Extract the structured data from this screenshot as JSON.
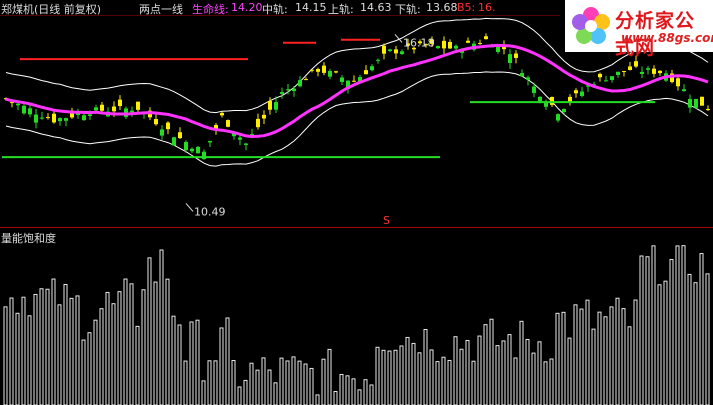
{
  "header": {
    "security": "郑煤机(日线 前复权)",
    "indicator_name": "两点一线",
    "life_line_label": "生命线:",
    "life_line_value": "14.20",
    "mid_label": "中轨:",
    "mid_value": "14.15",
    "upper_label": "上轨:",
    "upper_value": "14.63",
    "lower_label": "下轨:",
    "lower_value": "13.68",
    "b5_label": "B5:",
    "b5_value": "16."
  },
  "subchart": {
    "title": "量能饱和度"
  },
  "logo": {
    "brand": "分析家公式网",
    "url": "www.88gs.com"
  },
  "colors": {
    "up": "#22dd22",
    "down": "#ffee00",
    "life_line": "#ff33ff",
    "band": "#ffffff",
    "support": "#22dd22",
    "resistance": "#ff2222",
    "grid": "#aa0000"
  },
  "chart_data": {
    "type": "candlestick",
    "price_range": [
      10.0,
      16.8
    ],
    "annotations": [
      {
        "text": "10.49",
        "price": 10.49,
        "kind": "low"
      },
      {
        "text": "16.18",
        "price": 16.18,
        "kind": "high"
      },
      {
        "text": "S",
        "kind": "signal"
      }
    ],
    "support_lines": [
      12.05,
      13.9
    ],
    "resistance_lines": [
      15.35,
      15.9,
      16.0
    ],
    "volume_saturation_max": 100
  }
}
